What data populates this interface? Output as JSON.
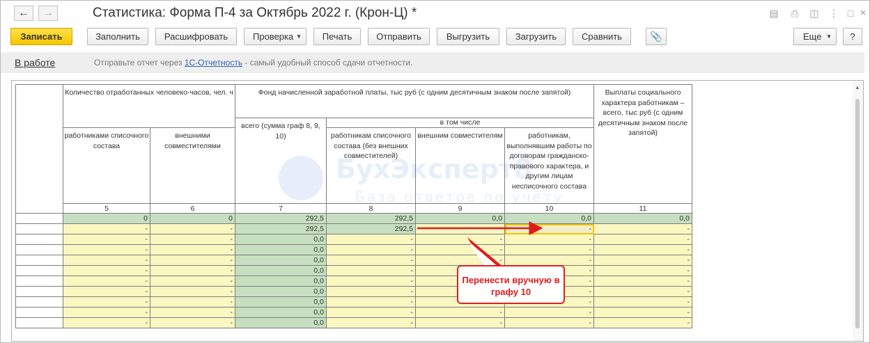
{
  "window": {
    "title": "Статистика: Форма П-4 за Октябрь 2022 г. (Крон-Ц) *"
  },
  "toolbar": {
    "save": "Записать",
    "fill": "Заполнить",
    "decode": "Расшифровать",
    "check": "Проверка",
    "print": "Печать",
    "send": "Отправить",
    "export": "Выгрузить",
    "import": "Загрузить",
    "compare": "Сравнить",
    "more": "Еще",
    "help": "?"
  },
  "infobar": {
    "status": "В работе",
    "text_before": "Отправьте отчет через ",
    "link": "1С-Отчетность",
    "text_after": " - самый удобный способ сдачи отчетности."
  },
  "table": {
    "headers": {
      "hours_group": "Количество отработанных человеко-часов, чел. ч",
      "pay_group": "Фонд начисленной заработной платы, тыс руб (с одним десятичным знаком после запятой)",
      "social": "Выплаты социального характера работникам – всего, тыс руб (с одним десятичным знаком после запятой)",
      "c5": "работниками списочного состава",
      "c6": "внешними совместителями",
      "c7": "всего (сумма граф 8, 9, 10)",
      "incl": "в том числе",
      "c8": "работникам списочного состава (без внешних совместителей)",
      "c9": "внешним совместителям",
      "c10": "работникам, выполнявшим работы по договорам гражданско-правового характера, и другим лицам несписочного состава"
    },
    "col_numbers": [
      "5",
      "6",
      "7",
      "8",
      "9",
      "10",
      "11"
    ],
    "rows": [
      [
        "0",
        "0",
        "292,5",
        "292,5",
        "0,0",
        "0,0",
        "0,0"
      ],
      [
        "-",
        "-",
        "292,5",
        "292,5",
        "-",
        "-",
        "-"
      ],
      [
        "-",
        "-",
        "0,0",
        "-",
        "-",
        "-",
        "-"
      ],
      [
        "-",
        "-",
        "0,0",
        "-",
        "-",
        "-",
        "-"
      ],
      [
        "-",
        "-",
        "0,0",
        "-",
        "-",
        "-",
        "-"
      ],
      [
        "-",
        "-",
        "0,0",
        "-",
        "-",
        "-",
        "-"
      ],
      [
        "-",
        "-",
        "0,0",
        "-",
        "-",
        "-",
        "-"
      ],
      [
        "-",
        "-",
        "0,0",
        "-",
        "-",
        "-",
        "-"
      ],
      [
        "-",
        "-",
        "0,0",
        "-",
        "-",
        "-",
        "-"
      ],
      [
        "-",
        "-",
        "0,0",
        "-",
        "-",
        "-",
        "-"
      ],
      [
        "-",
        "-",
        "0,0",
        "-",
        "-",
        "-",
        "-"
      ]
    ]
  },
  "watermark": {
    "brand": "БухЭксперт8",
    "tagline": "База ответов по учёту"
  },
  "annotation": {
    "text": "Перенести вручную в графу 10"
  },
  "colors": {
    "accent_yellow": "#f5c600",
    "cell_green": "#c6dfc0",
    "cell_yellow": "#fbf7c1",
    "annotation_red": "#e01b1b",
    "link_blue": "#2d64b4"
  }
}
